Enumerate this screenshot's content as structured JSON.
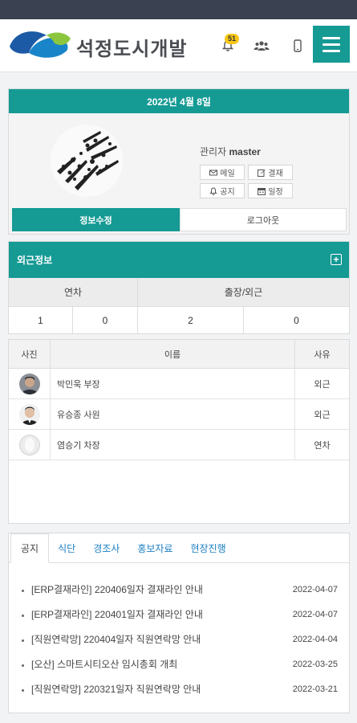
{
  "header": {
    "brand": "석정도시개발",
    "notification_count": "51",
    "icons": [
      "bell-icon",
      "people-icon",
      "mobile-icon",
      "hamburger-icon"
    ],
    "accent_color": "#159a94"
  },
  "profile": {
    "date": "2022년 4월 8일",
    "role": "관리자",
    "username": "master",
    "buttons": {
      "mail": "메일",
      "approval": "결재",
      "notice": "공지",
      "schedule": "일정"
    },
    "tab_info": "정보수정",
    "tab_logout": "로그아웃"
  },
  "outside": {
    "title": "외근정보",
    "headers": [
      "연차",
      "출장/외근"
    ],
    "values": [
      "1",
      "0",
      "2",
      "0"
    ]
  },
  "staff": {
    "headers": {
      "photo": "사진",
      "name": "이름",
      "reason": "사유"
    },
    "rows": [
      {
        "name": "박민욱 부장",
        "reason": "외근"
      },
      {
        "name": "유승종 사원",
        "reason": "외근"
      },
      {
        "name": "염승기 차장",
        "reason": "연차"
      }
    ]
  },
  "notice": {
    "tabs": [
      "공지",
      "식단",
      "경조사",
      "홍보자료",
      "현장진행"
    ],
    "items": [
      {
        "title": "[ERP결재라인] 220406일자 결재라인 안내",
        "date": "2022-04-07"
      },
      {
        "title": "[ERP결재라인] 220401일자 결재라인 안내",
        "date": "2022-04-07"
      },
      {
        "title": "[직원연락망] 220404일자 직원연락망 안내",
        "date": "2022-04-04"
      },
      {
        "title": "[오산] 스마트시티오산 임시총회 개최",
        "date": "2022-03-25"
      },
      {
        "title": "[직원연락망] 220321일자 직원연락망 안내",
        "date": "2022-03-21"
      }
    ]
  }
}
